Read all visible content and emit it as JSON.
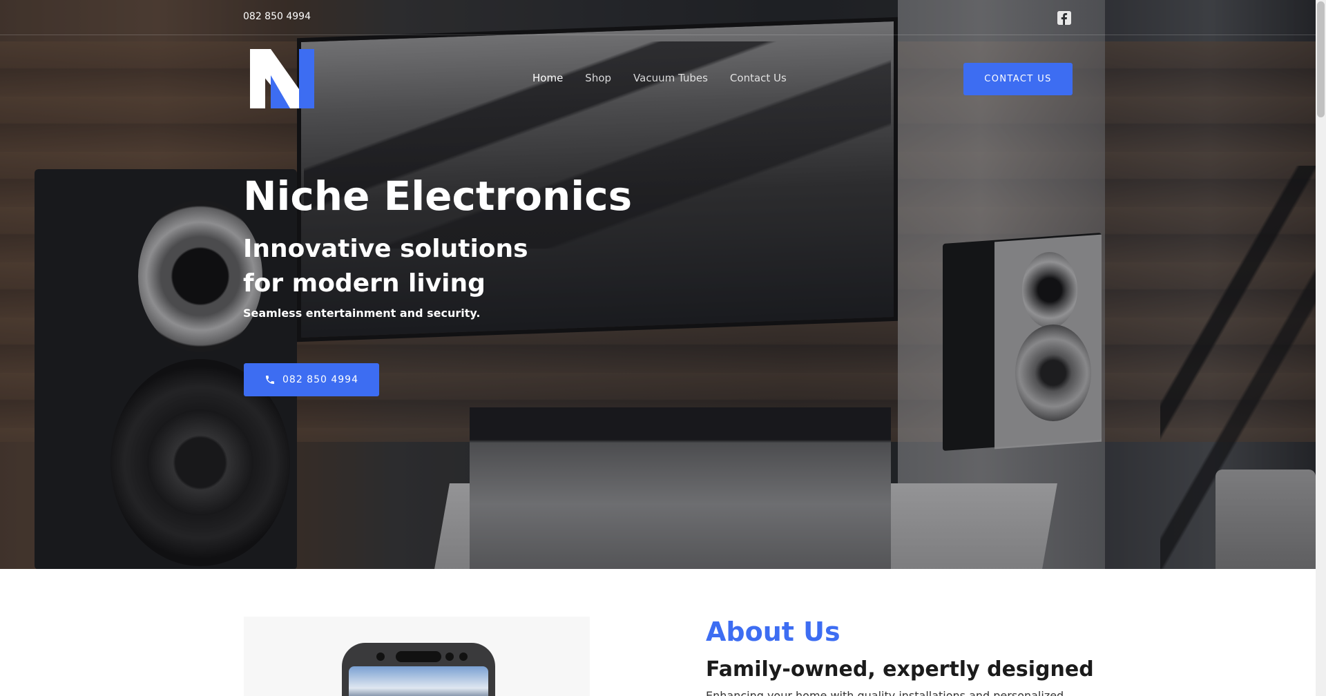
{
  "topbar": {
    "phone": "082 850 4994",
    "social_icon": "facebook-icon"
  },
  "header": {
    "logo_icon": "niche-electronics-logo",
    "nav": [
      {
        "label": "Home",
        "active": true
      },
      {
        "label": "Shop",
        "active": false
      },
      {
        "label": "Vacuum Tubes",
        "active": false
      },
      {
        "label": "Contact Us",
        "active": false
      }
    ],
    "contact_button": "CONTACT US"
  },
  "hero": {
    "title": "Niche Electronics",
    "subtitle_line1": "Innovative solutions",
    "subtitle_line2": "for modern living",
    "tagline": "Seamless entertainment and security.",
    "call_button": "082 850 4994",
    "call_icon": "phone-icon"
  },
  "about": {
    "heading": "About Us",
    "subheading": "Family-owned, expertly designed",
    "text": "Enhancing your home with quality installations and personalized"
  },
  "colors": {
    "accent": "#3d6df2",
    "hero_text": "#ffffff",
    "heading_dark": "#1b1b1b"
  }
}
